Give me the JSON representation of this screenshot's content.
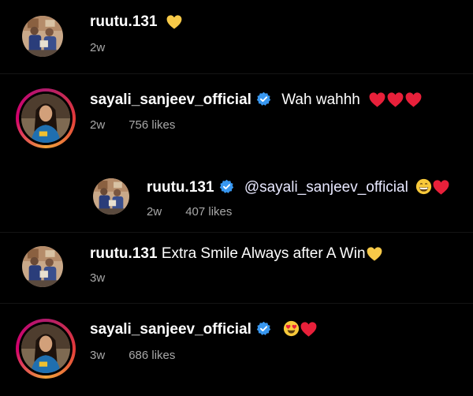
{
  "comments": [
    {
      "username": "ruutu.131",
      "text": "",
      "emojis": [
        "yellow-heart"
      ],
      "age": "2w",
      "likes": ""
    },
    {
      "username": "sayali_sanjeev_official",
      "verified": true,
      "text": "Wah wahhh",
      "emojis": [
        "red-heart",
        "red-heart",
        "red-heart"
      ],
      "age": "2w",
      "likes": "756 likes"
    },
    {
      "username": "ruutu.131",
      "verified": true,
      "text": "@sayali_sanjeev_official",
      "emojis": [
        "grinning-face",
        "red-heart"
      ],
      "age": "2w",
      "likes": "407 likes",
      "is_reply": true
    },
    {
      "username": "ruutu.131",
      "text": "Extra Smile Always after A Win",
      "emojis": [
        "yellow-heart"
      ],
      "age": "3w",
      "likes": ""
    },
    {
      "username": "sayali_sanjeev_official",
      "verified": true,
      "text": "",
      "emojis": [
        "heart-eyes-face",
        "red-heart"
      ],
      "age": "3w",
      "likes": "686 likes"
    }
  ],
  "colors": {
    "background": "#000000",
    "meta_text": "#a8a8a8",
    "verified_blue": "#3897f0",
    "red_heart": "#e8203a",
    "yellow_heart": "#f7c948"
  }
}
